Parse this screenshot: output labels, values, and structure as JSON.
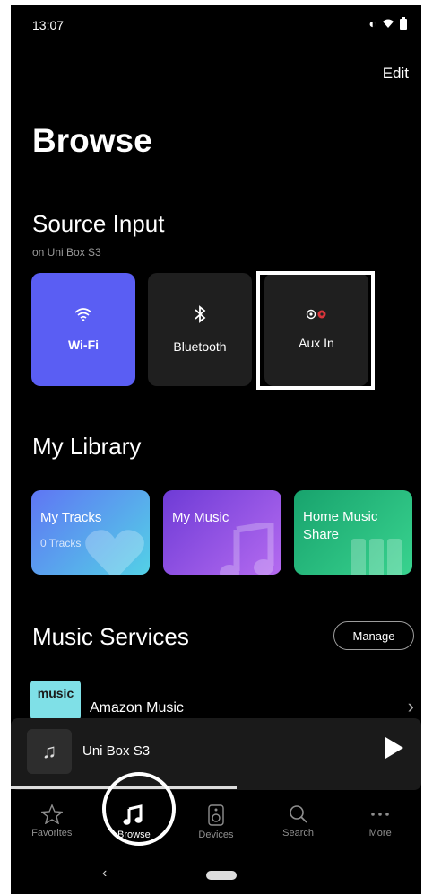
{
  "status_bar": {
    "time": "13:07",
    "notify_icon": "bluetooth-icon",
    "right_icons": [
      "vibrate-icon",
      "wifi-icon",
      "battery-icon"
    ]
  },
  "header": {
    "edit_label": "Edit",
    "title": "Browse"
  },
  "source_input": {
    "title": "Source Input",
    "subtitle": "on Uni Box S3",
    "items": [
      {
        "label": "Wi-Fi",
        "icon": "wifi-icon",
        "selected": true
      },
      {
        "label": "Bluetooth",
        "icon": "bluetooth-icon"
      },
      {
        "label": "Aux In",
        "icon": "aux-icon"
      }
    ]
  },
  "my_library": {
    "title": "My Library",
    "items": [
      {
        "label": "My Tracks",
        "sub": "0 Tracks"
      },
      {
        "label": "My Music"
      },
      {
        "label": "Home Music Share"
      }
    ]
  },
  "music_services": {
    "title": "Music Services",
    "manage_label": "Manage",
    "items": [
      {
        "name": "Amazon Music",
        "logo_text": "music"
      }
    ]
  },
  "now_playing": {
    "device": "Uni Box S3",
    "progress": 0.55
  },
  "tabs": [
    {
      "label": "Favorites",
      "icon": "star-icon"
    },
    {
      "label": "Browse",
      "icon": "music-note-icon",
      "active": true
    },
    {
      "label": "Devices",
      "icon": "speaker-icon"
    },
    {
      "label": "Search",
      "icon": "search-icon"
    },
    {
      "label": "More",
      "icon": "more-icon"
    }
  ],
  "colors": {
    "wifi_tile": "#5a5ef3",
    "background": "#000000"
  }
}
